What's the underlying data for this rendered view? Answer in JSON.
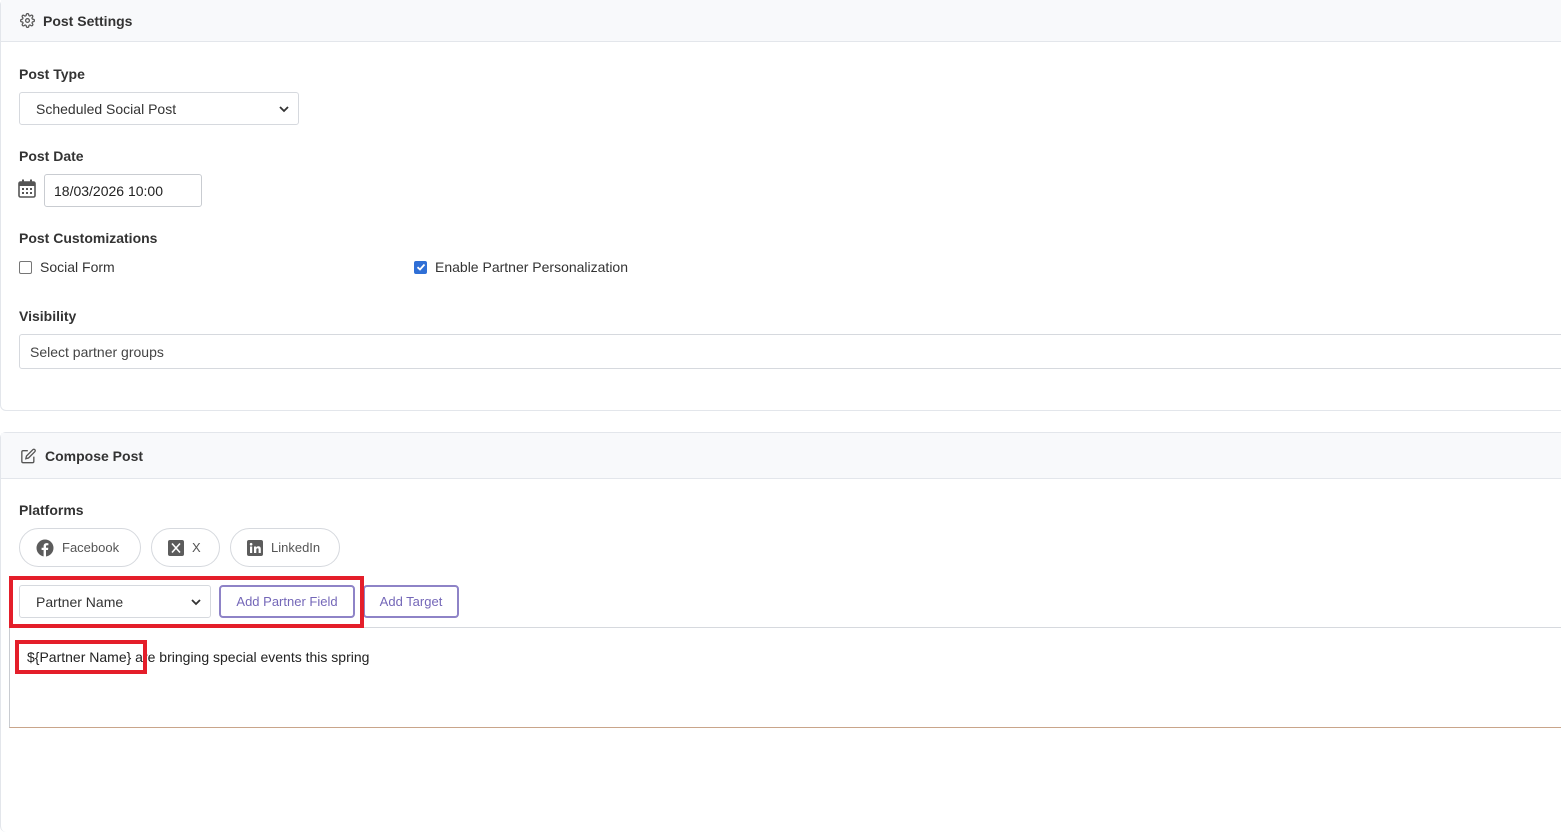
{
  "post_settings": {
    "header_title": "Post Settings",
    "icon": "gear-icon",
    "post_type_label": "Post Type",
    "post_type_value": "Scheduled Social Post",
    "post_date_label": "Post Date",
    "post_date_value": "18/03/2026 10:00",
    "customizations_label": "Post Customizations",
    "social_form_label": "Social Form",
    "social_form_checked": false,
    "partner_personalization_label": "Enable Partner Personalization",
    "partner_personalization_checked": true,
    "visibility_label": "Visibility",
    "visibility_placeholder": "Select partner groups"
  },
  "compose_post": {
    "header_title": "Compose Post",
    "icon": "edit-icon",
    "platforms_label": "Platforms",
    "platforms": [
      {
        "label": "Facebook",
        "icon": "facebook-icon"
      },
      {
        "label": "X",
        "icon": "x-icon"
      },
      {
        "label": "LinkedIn",
        "icon": "linkedin-icon"
      }
    ],
    "partner_field_value": "Partner Name",
    "add_partner_field_label": "Add Partner Field",
    "add_target_label": "Add Target",
    "editor_token": "${Partner Name}",
    "editor_text": " are bringing special events this spring"
  },
  "colors": {
    "highlight": "#e41e2a",
    "accent_button": "#7467b8",
    "checkbox_checked": "#2f6fd6"
  }
}
